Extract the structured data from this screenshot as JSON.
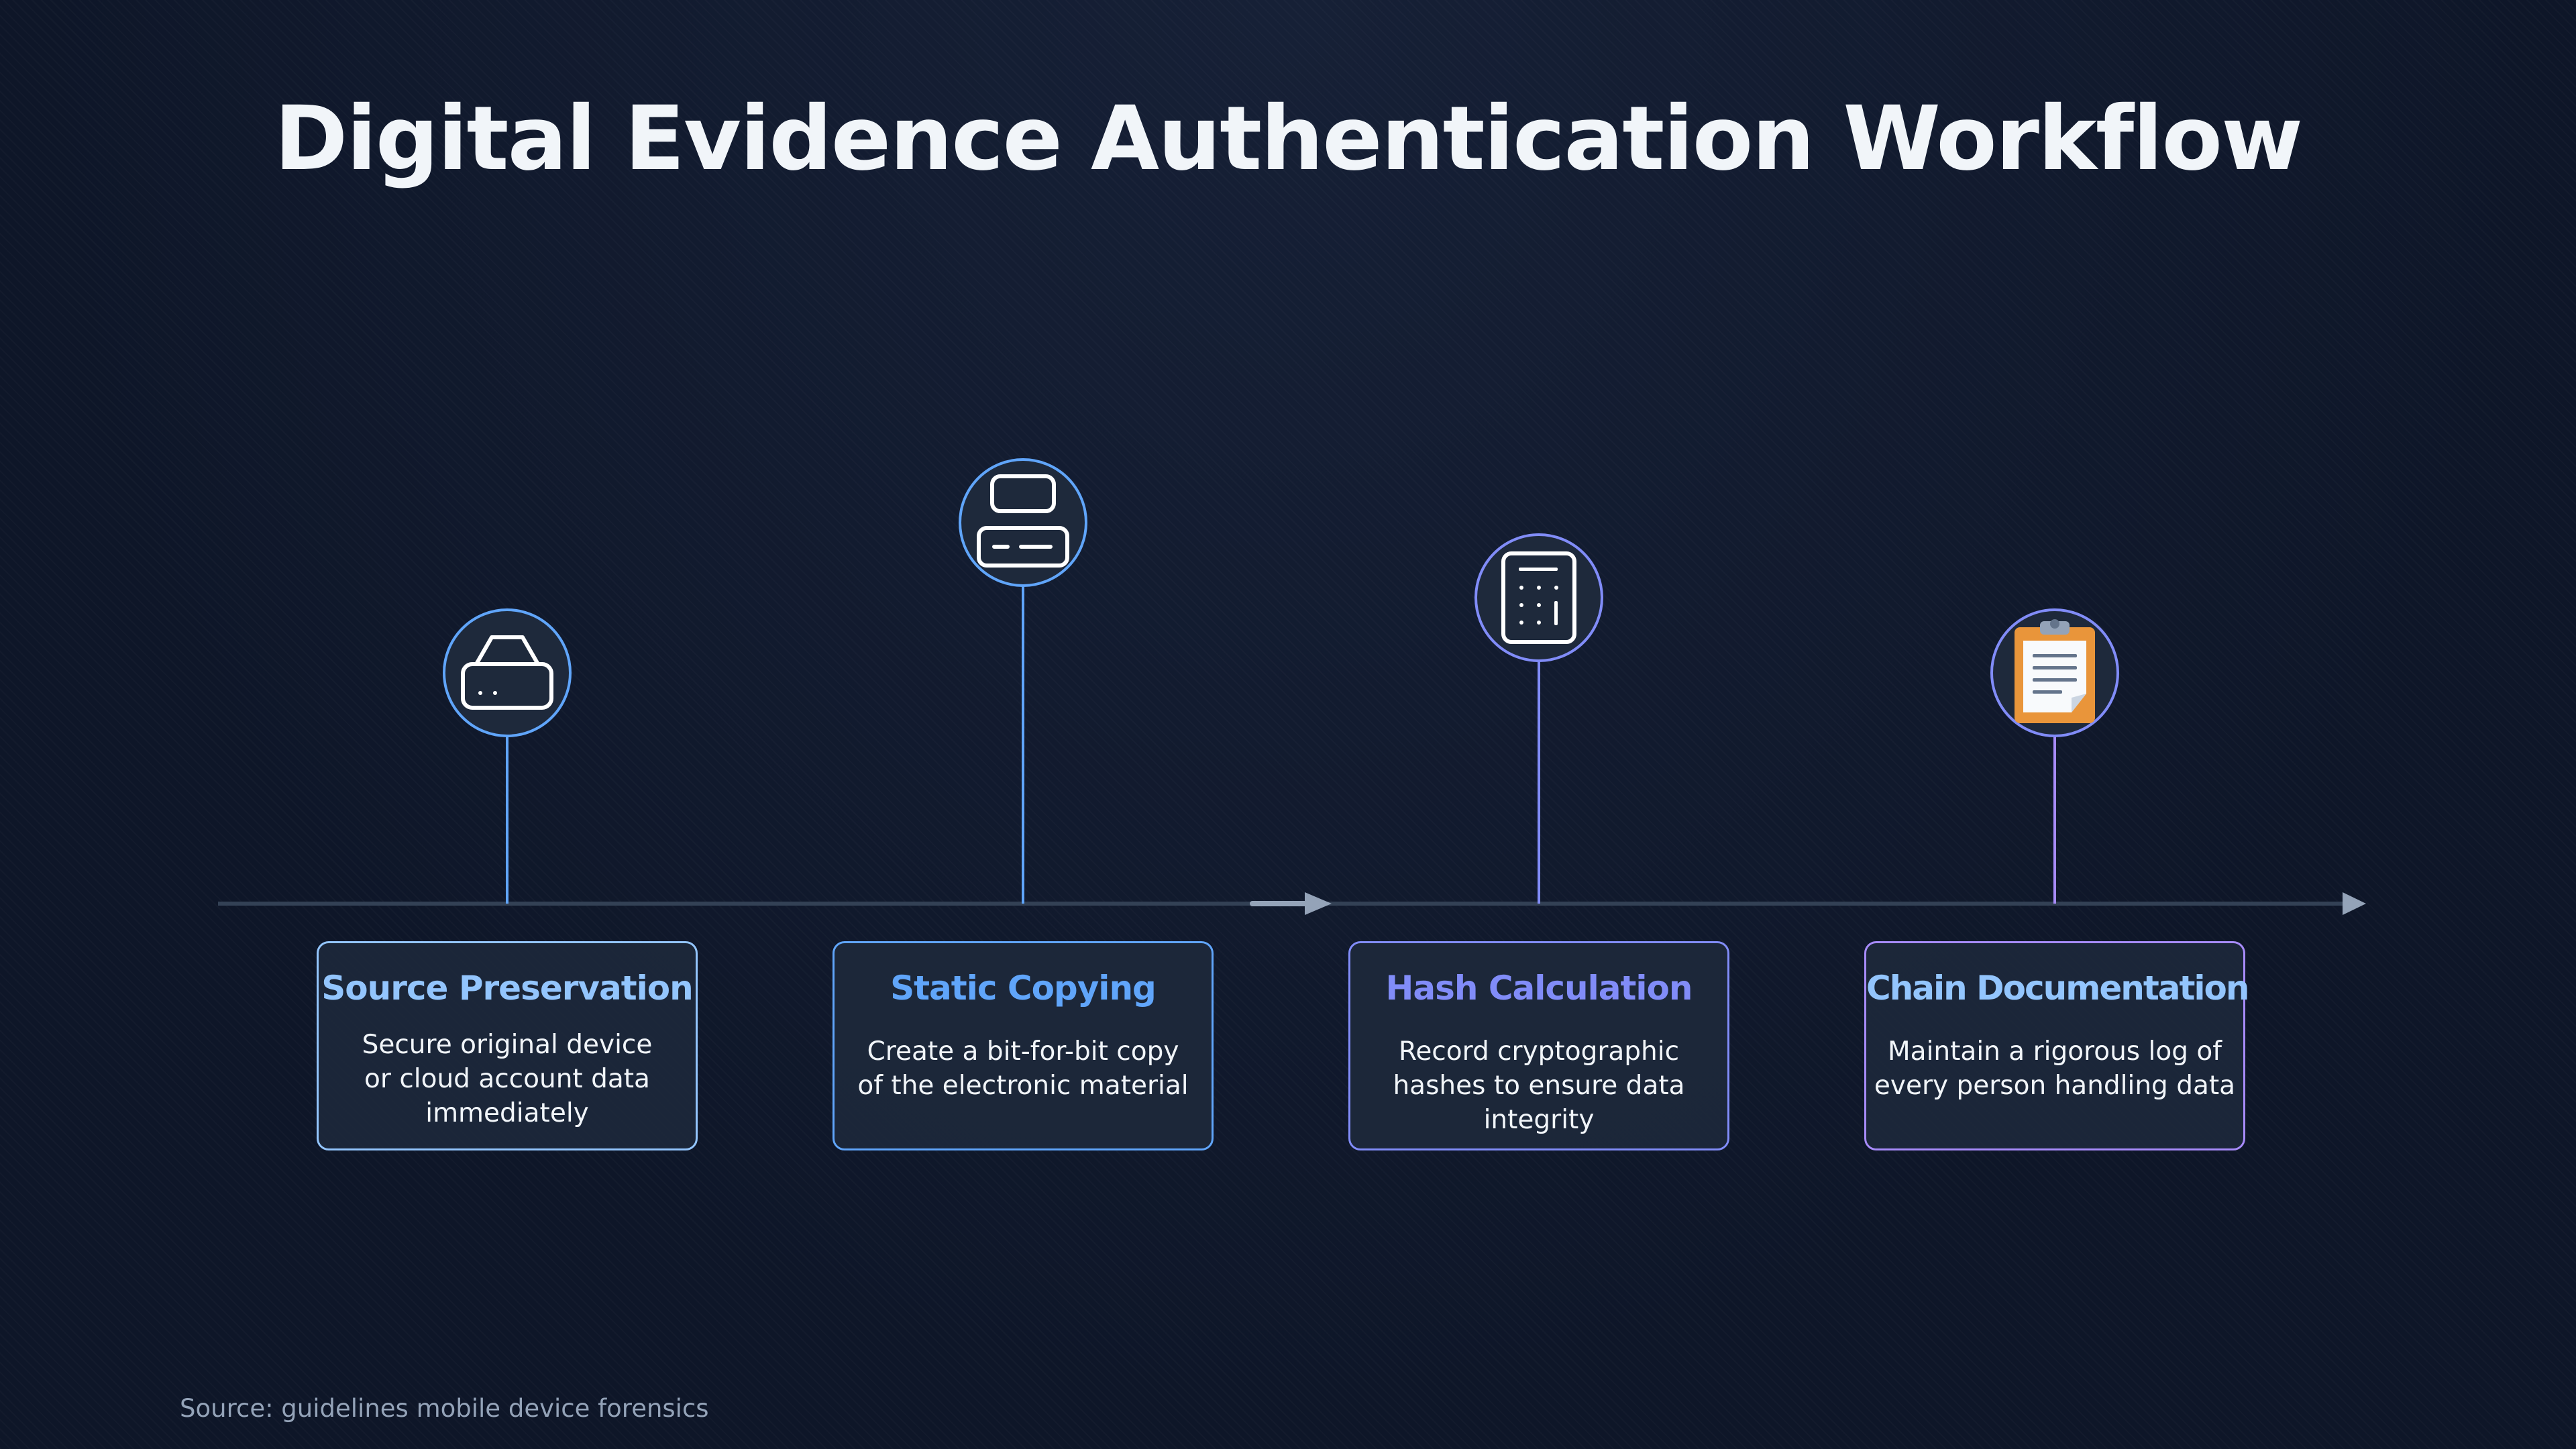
{
  "title": "Digital Evidence Authentication Workflow",
  "source": "Source: guidelines mobile device forensics",
  "steps": [
    {
      "title": "Source Preservation",
      "description": "Secure original device or cloud account data immediately",
      "icon": "hard-drive-icon",
      "color": "#93c5fd"
    },
    {
      "title": "Static Copying",
      "description": "Create a bit-for-bit copy of the electronic material",
      "icon": "server-icon",
      "color": "#60a5fa"
    },
    {
      "title": "Hash Calculation",
      "description": "Record cryptographic hashes to ensure data integrity",
      "icon": "calculator-icon",
      "color": "#818cf8"
    },
    {
      "title": "Chain Documentation",
      "description": "Maintain a rigorous log of every person handling data",
      "icon": "clipboard-icon",
      "color": "#a78bfa"
    }
  ],
  "colors": {
    "background": "#0f172a",
    "axis": "#334155",
    "arrow": "#94a3b8",
    "clipboard": "#e9953a"
  }
}
